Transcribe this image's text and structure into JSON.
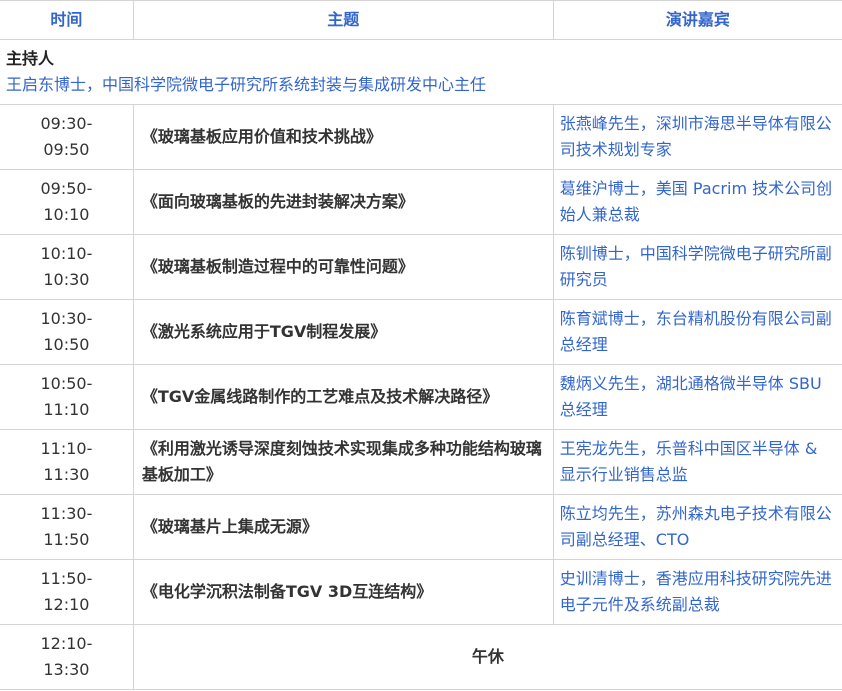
{
  "headers": {
    "time": "时间",
    "topic": "主题",
    "speaker": "演讲嘉宾"
  },
  "host": {
    "title": "主持人",
    "name": "王启东博士，中国科学院微电子研究所系统封装与集成研发中心主任"
  },
  "sessions": [
    {
      "time_start": "09:30-",
      "time_end": "09:50",
      "topic": "《玻璃基板应用价值和技术挑战》",
      "speaker": "张燕峰先生，深圳市海思半导体有限公司技术规划专家"
    },
    {
      "time_start": "09:50-",
      "time_end": "10:10",
      "topic": "《面向玻璃基板的先进封装解决方案》",
      "speaker": "葛维沪博士，美国 Pacrim 技术公司创始人兼总裁"
    },
    {
      "time_start": "10:10-",
      "time_end": "10:30",
      "topic": "《玻璃基板制造过程中的可靠性问题》",
      "speaker": "陈钏博士，中国科学院微电子研究所副研究员"
    },
    {
      "time_start": "10:30-",
      "time_end": "10:50",
      "topic": "《激光系统应用于TGV制程发展》",
      "speaker": "陈育斌博士，东台精机股份有限公司副总经理"
    },
    {
      "time_start": "10:50-",
      "time_end": "11:10",
      "topic": "《TGV金属线路制作的工艺难点及技术解决路径》",
      "speaker": "魏炳义先生，湖北通格微半导体 SBU 总经理"
    },
    {
      "time_start": "11:10-",
      "time_end": "11:30",
      "topic": "《利用激光诱导深度刻蚀技术实现集成多种功能结构玻璃基板加工》",
      "speaker": "王宪龙先生，乐普科中国区半导体 & 显示行业销售总监"
    },
    {
      "time_start": "11:30-",
      "time_end": "11:50",
      "topic": "《玻璃基片上集成无源》",
      "speaker": "陈立均先生，苏州森丸电子技术有限公司副总经理、CTO"
    },
    {
      "time_start": "11:50-",
      "time_end": "12:10",
      "topic": "《电化学沉积法制备TGV 3D互连结构》",
      "speaker": "史训清博士，香港应用科技研究院先进电子元件及系统副总裁"
    }
  ],
  "lunch": {
    "time_start": "12:10-",
    "time_end": "13:30",
    "label": "午休"
  }
}
